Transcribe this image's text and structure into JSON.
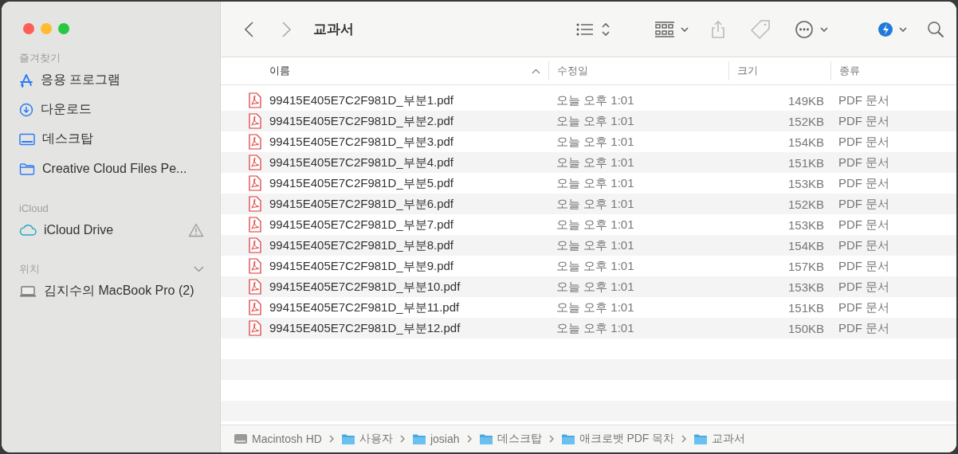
{
  "window": {
    "title": "교과서"
  },
  "sidebar": {
    "sections": [
      {
        "heading": "즐겨찾기",
        "items": [
          {
            "label": "응용 프로그램"
          },
          {
            "label": "다운로드"
          },
          {
            "label": "데스크탑"
          },
          {
            "label": "Creative Cloud Files Pe..."
          }
        ]
      },
      {
        "heading": "iCloud",
        "items": [
          {
            "label": "iCloud Drive",
            "warning": true
          }
        ]
      },
      {
        "heading": "위치",
        "collapsible": true,
        "items": [
          {
            "label": "김지수의 MacBook Pro (2)"
          }
        ]
      }
    ]
  },
  "table": {
    "columns": [
      {
        "label": "이름",
        "sorted": true
      },
      {
        "label": "수정일"
      },
      {
        "label": "크기"
      },
      {
        "label": "종류"
      }
    ],
    "rows": [
      {
        "name": "99415E405E7C2F981D_부분1.pdf",
        "modified": "오늘 오후 1:01",
        "size": "149KB",
        "kind": "PDF 문서"
      },
      {
        "name": "99415E405E7C2F981D_부분2.pdf",
        "modified": "오늘 오후 1:01",
        "size": "152KB",
        "kind": "PDF 문서"
      },
      {
        "name": "99415E405E7C2F981D_부분3.pdf",
        "modified": "오늘 오후 1:01",
        "size": "154KB",
        "kind": "PDF 문서"
      },
      {
        "name": "99415E405E7C2F981D_부분4.pdf",
        "modified": "오늘 오후 1:01",
        "size": "151KB",
        "kind": "PDF 문서"
      },
      {
        "name": "99415E405E7C2F981D_부분5.pdf",
        "modified": "오늘 오후 1:01",
        "size": "153KB",
        "kind": "PDF 문서"
      },
      {
        "name": "99415E405E7C2F981D_부분6.pdf",
        "modified": "오늘 오후 1:01",
        "size": "152KB",
        "kind": "PDF 문서"
      },
      {
        "name": "99415E405E7C2F981D_부분7.pdf",
        "modified": "오늘 오후 1:01",
        "size": "153KB",
        "kind": "PDF 문서"
      },
      {
        "name": "99415E405E7C2F981D_부분8.pdf",
        "modified": "오늘 오후 1:01",
        "size": "154KB",
        "kind": "PDF 문서"
      },
      {
        "name": "99415E405E7C2F981D_부분9.pdf",
        "modified": "오늘 오후 1:01",
        "size": "157KB",
        "kind": "PDF 문서"
      },
      {
        "name": "99415E405E7C2F981D_부분10.pdf",
        "modified": "오늘 오후 1:01",
        "size": "153KB",
        "kind": "PDF 문서"
      },
      {
        "name": "99415E405E7C2F981D_부분11.pdf",
        "modified": "오늘 오후 1:01",
        "size": "151KB",
        "kind": "PDF 문서"
      },
      {
        "name": "99415E405E7C2F981D_부분12.pdf",
        "modified": "오늘 오후 1:01",
        "size": "150KB",
        "kind": "PDF 문서"
      }
    ]
  },
  "path_bar": [
    {
      "label": "Macintosh HD"
    },
    {
      "label": "사용자"
    },
    {
      "label": "josiah"
    },
    {
      "label": "데스크탑"
    },
    {
      "label": "애크로뱃 PDF 목차"
    },
    {
      "label": "교과서"
    }
  ]
}
